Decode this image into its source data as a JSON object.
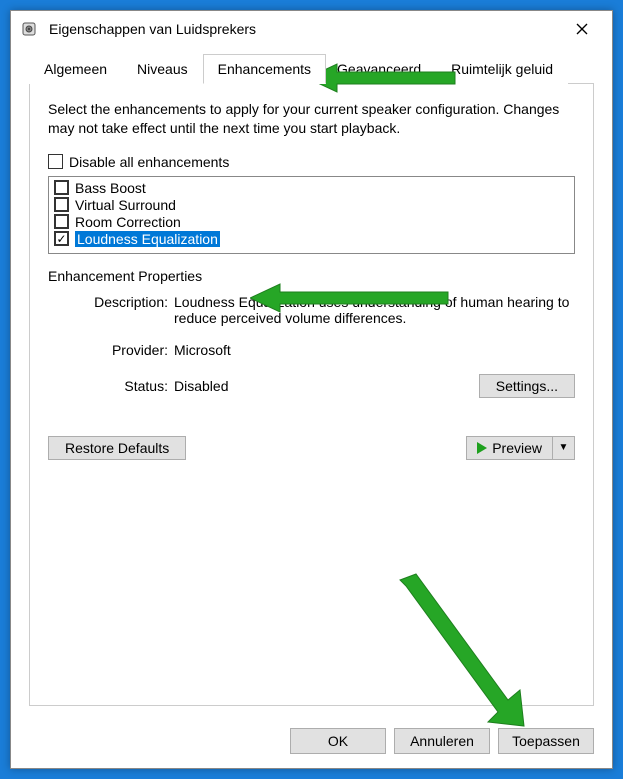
{
  "window": {
    "title": "Eigenschappen van Luidsprekers"
  },
  "tabs": {
    "items": [
      {
        "label": "Algemeen",
        "active": false
      },
      {
        "label": "Niveaus",
        "active": false
      },
      {
        "label": "Enhancements",
        "active": true
      },
      {
        "label": "Geavanceerd",
        "active": false
      },
      {
        "label": "Ruimtelijk geluid",
        "active": false
      }
    ]
  },
  "enhancements": {
    "intro": "Select the enhancements to apply for your current speaker configuration. Changes may not take effect until the next time you start playback.",
    "disable_all_label": "Disable all enhancements",
    "disable_all_checked": false,
    "list": [
      {
        "label": "Bass Boost",
        "checked": false,
        "selected": false
      },
      {
        "label": "Virtual Surround",
        "checked": false,
        "selected": false
      },
      {
        "label": "Room Correction",
        "checked": false,
        "selected": false
      },
      {
        "label": "Loudness Equalization",
        "checked": true,
        "selected": true
      }
    ]
  },
  "properties": {
    "header": "Enhancement Properties",
    "description_label": "Description:",
    "description_value": "Loudness Equalization uses understanding of human hearing to reduce perceived volume differences.",
    "provider_label": "Provider:",
    "provider_value": "Microsoft",
    "status_label": "Status:",
    "status_value": "Disabled",
    "settings_button": "Settings..."
  },
  "actions": {
    "restore_defaults": "Restore Defaults",
    "preview": "Preview"
  },
  "footer": {
    "ok": "OK",
    "cancel": "Annuleren",
    "apply": "Toepassen"
  }
}
